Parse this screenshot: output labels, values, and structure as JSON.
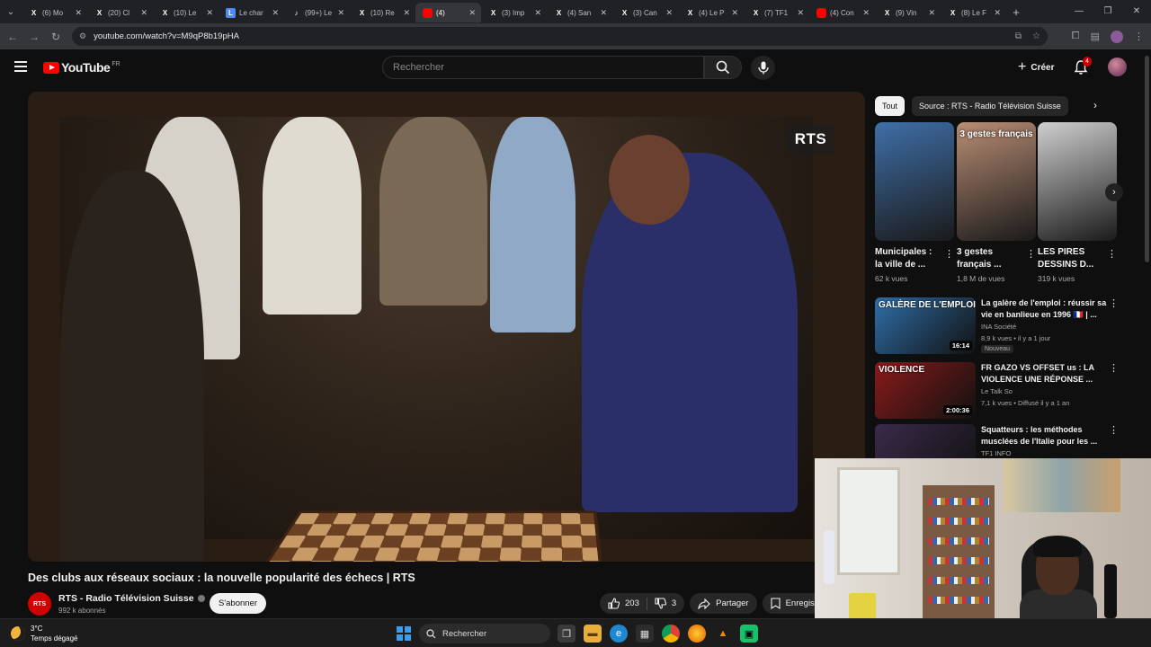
{
  "browser": {
    "tabs": [
      {
        "icon": "x-icon",
        "title": "(6) Mo"
      },
      {
        "icon": "x-icon",
        "title": "(20) Cl"
      },
      {
        "icon": "x-icon",
        "title": "(10) Le"
      },
      {
        "icon": "doc-icon",
        "title": "Le char"
      },
      {
        "icon": "tiktok-icon",
        "title": "(99+) Le"
      },
      {
        "icon": "x-icon",
        "title": "(10) Re"
      },
      {
        "icon": "youtube-icon",
        "title": "(4)",
        "active": true
      },
      {
        "icon": "x-icon",
        "title": "(3) Imp"
      },
      {
        "icon": "x-icon",
        "title": "(4) San"
      },
      {
        "icon": "x-icon",
        "title": "(3) Can"
      },
      {
        "icon": "x-icon",
        "title": "(4) Le P"
      },
      {
        "icon": "x-icon",
        "title": "(7) TF1"
      },
      {
        "icon": "youtube-icon",
        "title": "(4) Con"
      },
      {
        "icon": "x-icon",
        "title": "(9) Vin"
      },
      {
        "icon": "x-icon",
        "title": "(8) Le F"
      }
    ],
    "url": "youtube.com/watch?v=M9qP8b19pHA"
  },
  "header": {
    "logo_text": "YouTube",
    "country_code": "FR",
    "search_placeholder": "Rechercher",
    "create_label": "Créer",
    "notification_count": "4"
  },
  "player": {
    "watermark": "RTS"
  },
  "video": {
    "title": "Des clubs aux réseaux sociaux : la nouvelle popularité des échecs | RTS",
    "channel_avatar": "RTS",
    "channel_name": "RTS - Radio Télévision Suisse",
    "subscribers": "992 k abonnés",
    "subscribe_label": "S'abonner",
    "likes": "203",
    "dislikes": "3",
    "share_label": "Partager",
    "save_label": "Enregis"
  },
  "chips": [
    "Tout",
    "Source : RTS - Radio Télévision Suisse"
  ],
  "shorts": [
    {
      "title": "Municipales : la ville de ...",
      "views": "62 k vues",
      "thumb_color": "#3f6fa8"
    },
    {
      "title": "3 gestes français ...",
      "views": "1,8 M de vues",
      "thumb_color": "#b98d74",
      "overlay": "3 gestes français"
    },
    {
      "title": "LES PIRES DESSINS D...",
      "views": "319 k vues",
      "thumb_color": "#cfcfcf"
    }
  ],
  "videos": [
    {
      "title": "La galère de l'emploi : réussir sa vie en banlieue en 1996 🇫🇷 | ...",
      "channel": "INA Société",
      "meta": "8,9 k vues • il y a 1 jour",
      "badge": "Nouveau",
      "duration": "16:14",
      "thumb_text": "GALÈRE DE L'EMPLOI",
      "thumb_color": "#2f6ea8"
    },
    {
      "title": "FR GAZO VS OFFSET us : LA VIOLENCE UNE RÉPONSE ...",
      "channel": "Le Talk So",
      "meta": "7,1 k vues • Diffusé il y a 1 an",
      "duration": "2:00:36",
      "thumb_text": "VIOLENCE",
      "thumb_color": "#8a1a1a"
    },
    {
      "title": "Squatteurs : les méthodes musclées de l'Italie pour les ...",
      "channel": "TF1 INFO",
      "thumb_color": "#3a2a4a"
    }
  ],
  "taskbar": {
    "temperature": "3°C",
    "weather": "Temps dégagé",
    "search_label": "Rechercher"
  },
  "colors": {
    "background": "#0f0f0f",
    "youtube_red": "#ff0000",
    "surface": "#272727"
  }
}
